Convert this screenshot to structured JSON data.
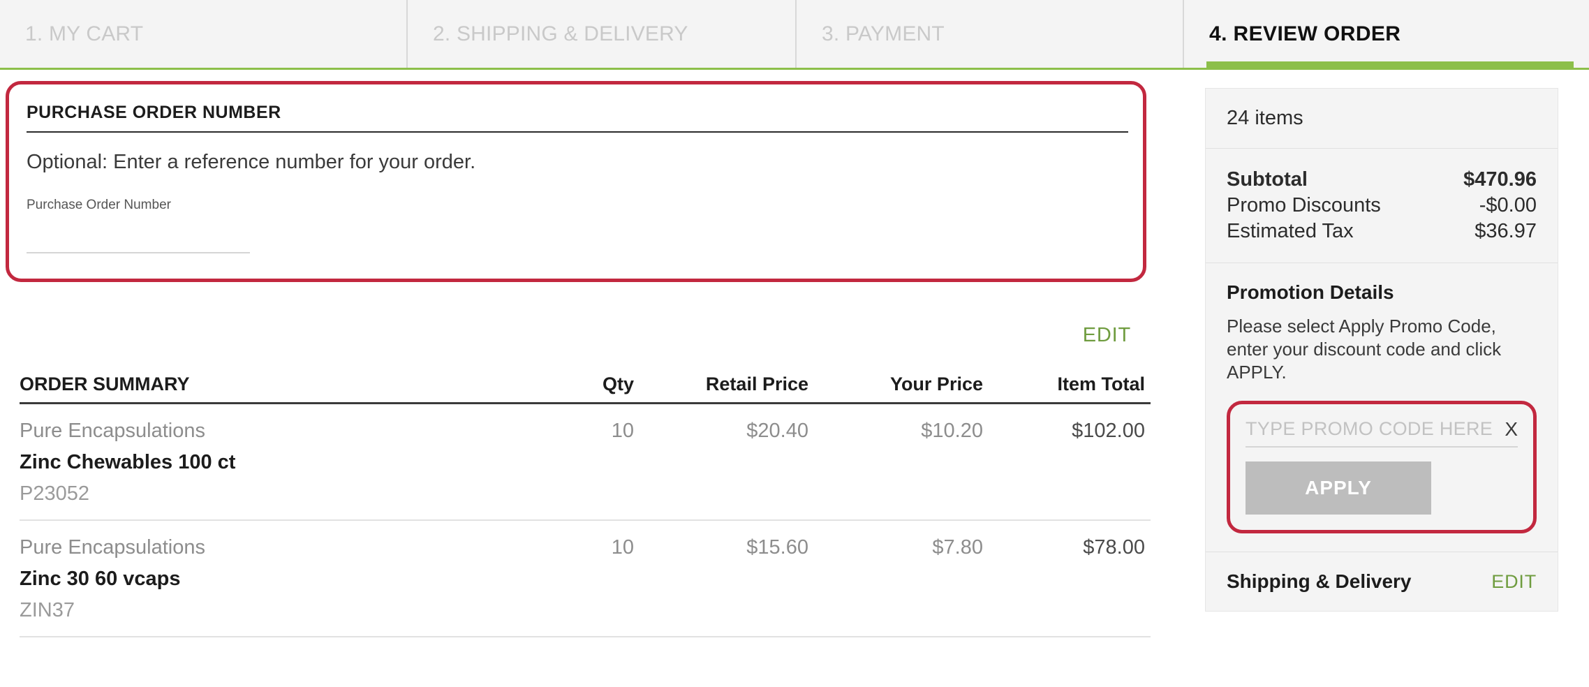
{
  "steps": [
    {
      "label": "1. MY CART",
      "active": false
    },
    {
      "label": "2. SHIPPING & DELIVERY",
      "active": false
    },
    {
      "label": "3. PAYMENT",
      "active": false
    },
    {
      "label": "4. REVIEW ORDER",
      "active": true
    }
  ],
  "purchase_order": {
    "title": "PURCHASE ORDER NUMBER",
    "description": "Optional: Enter a reference number for your order.",
    "field_label": "Purchase Order Number",
    "field_value": "",
    "field_placeholder": "",
    "highlight_color": "#c2283f"
  },
  "order_summary": {
    "edit_label": "EDIT",
    "columns": {
      "name": "ORDER SUMMARY",
      "qty": "Qty",
      "retail_price": "Retail Price",
      "your_price": "Your Price",
      "item_total": "Item Total"
    },
    "rows": [
      {
        "brand": "Pure Encapsulations",
        "name": "Zinc Chewables 100 ct",
        "sku": "P23052",
        "qty": "10",
        "retail_price": "$20.40",
        "your_price": "$10.20",
        "item_total": "$102.00"
      },
      {
        "brand": "Pure Encapsulations",
        "name": "Zinc 30 60 vcaps",
        "sku": "ZIN37",
        "qty": "10",
        "retail_price": "$15.60",
        "your_price": "$7.80",
        "item_total": "$78.00"
      }
    ]
  },
  "sidebar": {
    "items_count": "24 items",
    "totals": [
      {
        "label": "Subtotal",
        "value": "$470.96",
        "bold": true
      },
      {
        "label": "Promo Discounts",
        "value": "-$0.00",
        "bold": false
      },
      {
        "label": "Estimated Tax",
        "value": "$36.97",
        "bold": false
      }
    ],
    "promotion": {
      "title": "Promotion Details",
      "description": "Please select Apply Promo Code, enter your discount code and click APPLY.",
      "input_value": "",
      "input_placeholder": "TYPE PROMO CODE HERE",
      "clear_label": "X",
      "apply_label": "APPLY",
      "highlight_color": "#c2283f"
    },
    "shipping": {
      "title": "Shipping & Delivery",
      "edit_label": "EDIT"
    }
  },
  "theme": {
    "accent_green": "#8cbf4a",
    "link_green": "#6f9c3f",
    "highlight_red": "#c2283f",
    "panel_gray": "#f4f4f4"
  }
}
